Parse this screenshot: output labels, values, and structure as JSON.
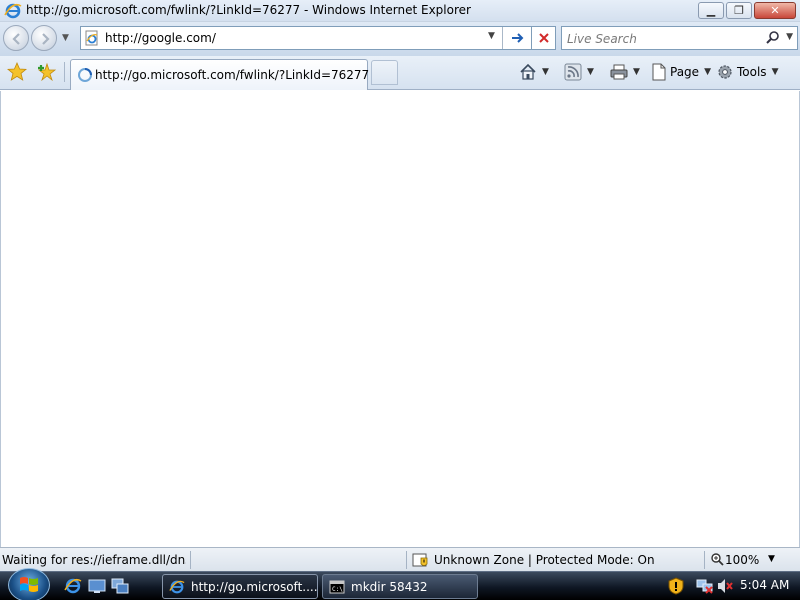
{
  "window": {
    "title": "http://go.microsoft.com/fwlink/?LinkId=76277 - Windows Internet Explorer",
    "minimize_icon": "minimize-icon",
    "maximize_icon": "restore-icon",
    "close_icon": "close-icon"
  },
  "navbar": {
    "address_value": "http://google.com/",
    "search_placeholder": "Live Search"
  },
  "tabs": [
    {
      "label": "http://go.microsoft.com/fwlink/?LinkId=76277"
    }
  ],
  "commands": {
    "page_label": "Page",
    "tools_label": "Tools"
  },
  "status": {
    "text": "Waiting for res://ieframe.dll/dnserror.htm",
    "zone": "Unknown Zone | Protected Mode: On",
    "zoom": "100%"
  },
  "taskbar": {
    "tasks": [
      {
        "label": "http://go.microsoft...."
      },
      {
        "label": "mkdir  58432"
      }
    ],
    "clock": "5:04 AM"
  },
  "colors": {
    "accent": "#1f5fb4",
    "taskbar": "#0f1724",
    "stop_red": "#d22a2a"
  }
}
